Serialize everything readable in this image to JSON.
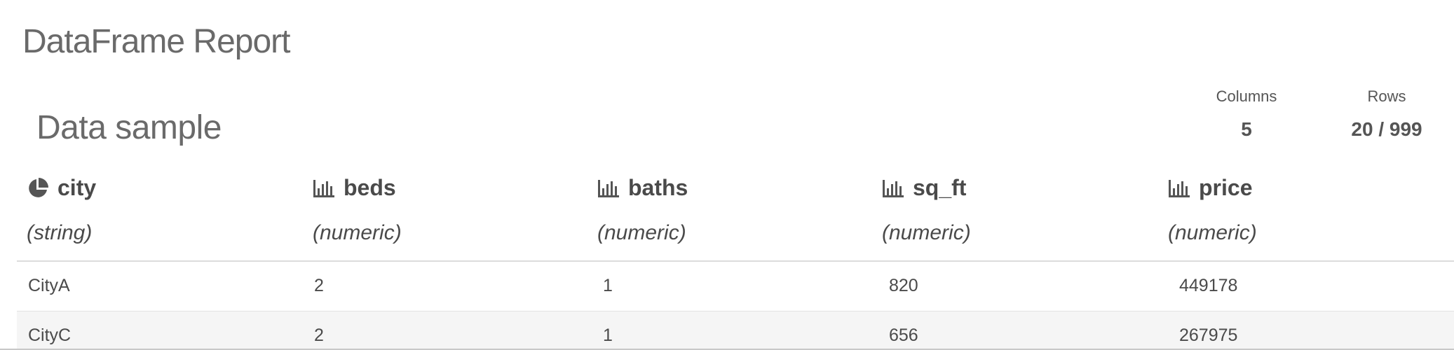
{
  "report": {
    "title": "DataFrame Report"
  },
  "section": {
    "title": "Data sample"
  },
  "stats": {
    "columns_label": "Columns",
    "columns_value": "5",
    "rows_label": "Rows",
    "rows_value": "20 / 999"
  },
  "table": {
    "columns": [
      {
        "name": "city",
        "type": "(string)",
        "icon": "pie-chart-icon"
      },
      {
        "name": "beds",
        "type": "(numeric)",
        "icon": "bar-chart-icon"
      },
      {
        "name": "baths",
        "type": "(numeric)",
        "icon": "bar-chart-icon"
      },
      {
        "name": "sq_ft",
        "type": "(numeric)",
        "icon": "bar-chart-icon"
      },
      {
        "name": "price",
        "type": "(numeric)",
        "icon": "bar-chart-icon"
      }
    ],
    "rows": [
      [
        "CityA",
        "2",
        "1",
        "820",
        "449178"
      ],
      [
        "CityC",
        "2",
        "1",
        "656",
        "267975"
      ]
    ]
  },
  "colors": {
    "text": "#4a4a4a",
    "title": "#6a6a6a",
    "alt_row": "#f5f5f5",
    "divider": "#dcdcdc"
  }
}
